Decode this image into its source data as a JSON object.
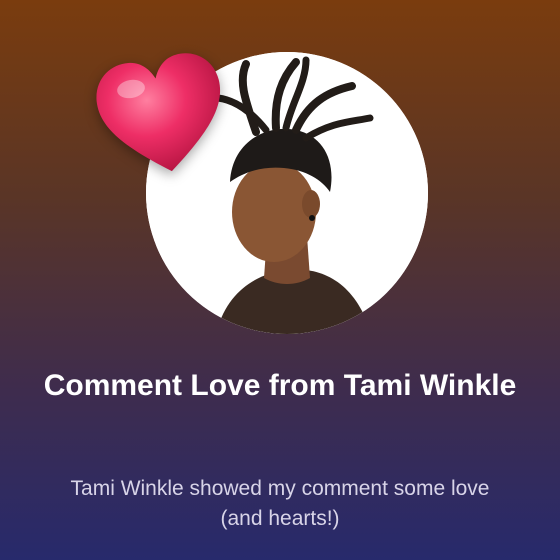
{
  "notification": {
    "title": "Comment Love from Tami Winkle",
    "subtitle": "Tami Winkle showed my comment some love (and hearts!)"
  },
  "icons": {
    "reaction": "heart-icon",
    "profile": "avatar"
  },
  "colors": {
    "gradient_top": "#7a3c0e",
    "gradient_bottom": "#272a6c",
    "heart": "#e8245c",
    "title_text": "#ffffff",
    "subtitle_text": "#d8d4e8"
  }
}
